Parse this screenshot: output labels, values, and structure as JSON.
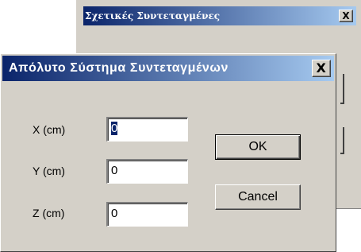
{
  "back_dialog": {
    "title": "Σχετικές Συντεταγμένες",
    "close_label": "X"
  },
  "front_dialog": {
    "title": "Απόλυτο Σύστημα Συντεταγμένων",
    "close_label": "X",
    "fields": [
      {
        "label": "X (cm)",
        "value": "0"
      },
      {
        "label": "Y (cm)",
        "value": "0"
      },
      {
        "label": "Z (cm)",
        "value": "0"
      }
    ],
    "ok_label": "OK",
    "cancel_label": "Cancel"
  }
}
